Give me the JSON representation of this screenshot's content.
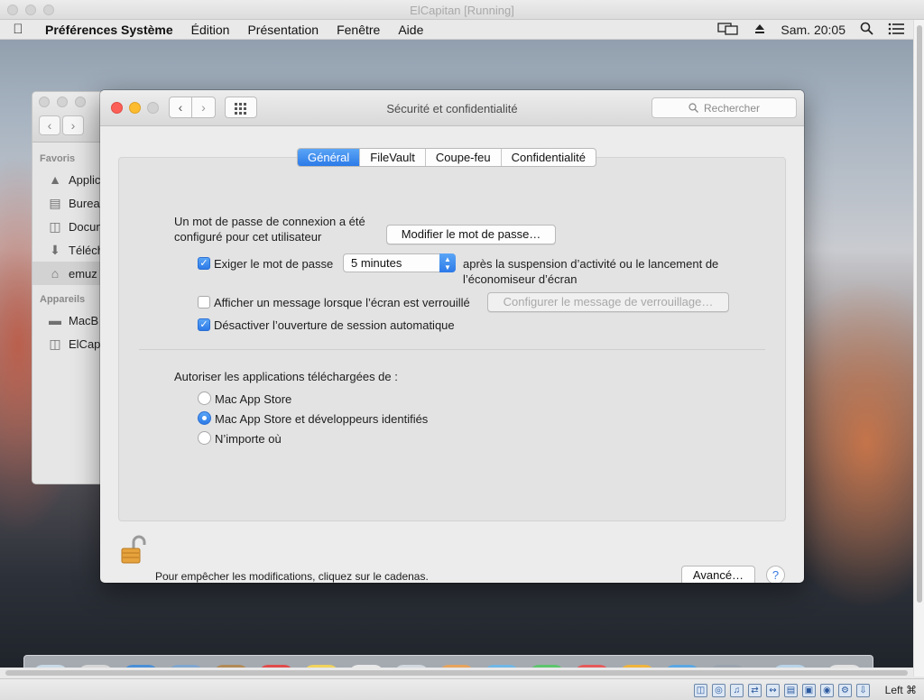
{
  "host": {
    "window_title": "ElCapitan [Running]",
    "host_key": "Left ⌘"
  },
  "menubar": {
    "app_name": "Préférences Système",
    "items": [
      "Édition",
      "Présentation",
      "Fenêtre",
      "Aide"
    ],
    "clock": "Sam. 20:05"
  },
  "finder": {
    "sections": {
      "favorites": "Favoris",
      "devices": "Appareils"
    },
    "favorites": [
      {
        "label": "Applic",
        "icon": "applications-icon"
      },
      {
        "label": "Burea",
        "icon": "desktop-icon"
      },
      {
        "label": "Docun",
        "icon": "documents-icon"
      },
      {
        "label": "Téléch",
        "icon": "downloads-icon"
      },
      {
        "label": "emuz",
        "icon": "home-icon"
      }
    ],
    "devices": [
      {
        "label": "MacB",
        "icon": "laptop-icon"
      },
      {
        "label": "ElCap",
        "icon": "disk-icon"
      }
    ]
  },
  "prefs": {
    "window_title": "Sécurité et confidentialité",
    "search_placeholder": "Rechercher",
    "tabs": [
      "Général",
      "FileVault",
      "Coupe-feu",
      "Confidentialité"
    ],
    "active_tab": "Général",
    "password_set_line1": "Un mot de passe de connexion a été",
    "password_set_line2": "configuré pour cet utilisateur",
    "change_password_button": "Modifier le mot de passe…",
    "require_password_label": "Exiger le mot de passe",
    "require_password_checked": true,
    "require_password_delay": "5 minutes",
    "require_password_after_line1": "après la suspension d’activité ou le lancement de",
    "require_password_after_line2": "l’économiseur d’écran",
    "show_message_label": "Afficher un message lorsque l’écran est verrouillé",
    "show_message_checked": false,
    "set_lock_message_button": "Configurer le message de verrouillage…",
    "disable_auto_login_label": "Désactiver l’ouverture de session automatique",
    "disable_auto_login_checked": true,
    "allow_apps_heading": "Autoriser les applications téléchargées de :",
    "allow_apps_options": [
      "Mac App Store",
      "Mac App Store et développeurs identifiés",
      "N’importe où"
    ],
    "allow_apps_selected": "Mac App Store et développeurs identifiés",
    "lock_message": "Pour empêcher les modifications, cliquez sur le cadenas.",
    "advanced_button": "Avancé…",
    "help_button": "?"
  },
  "colors": {
    "accent": "#2c7ae8",
    "close": "#fc5f57",
    "minimize": "#fdbc2e"
  }
}
